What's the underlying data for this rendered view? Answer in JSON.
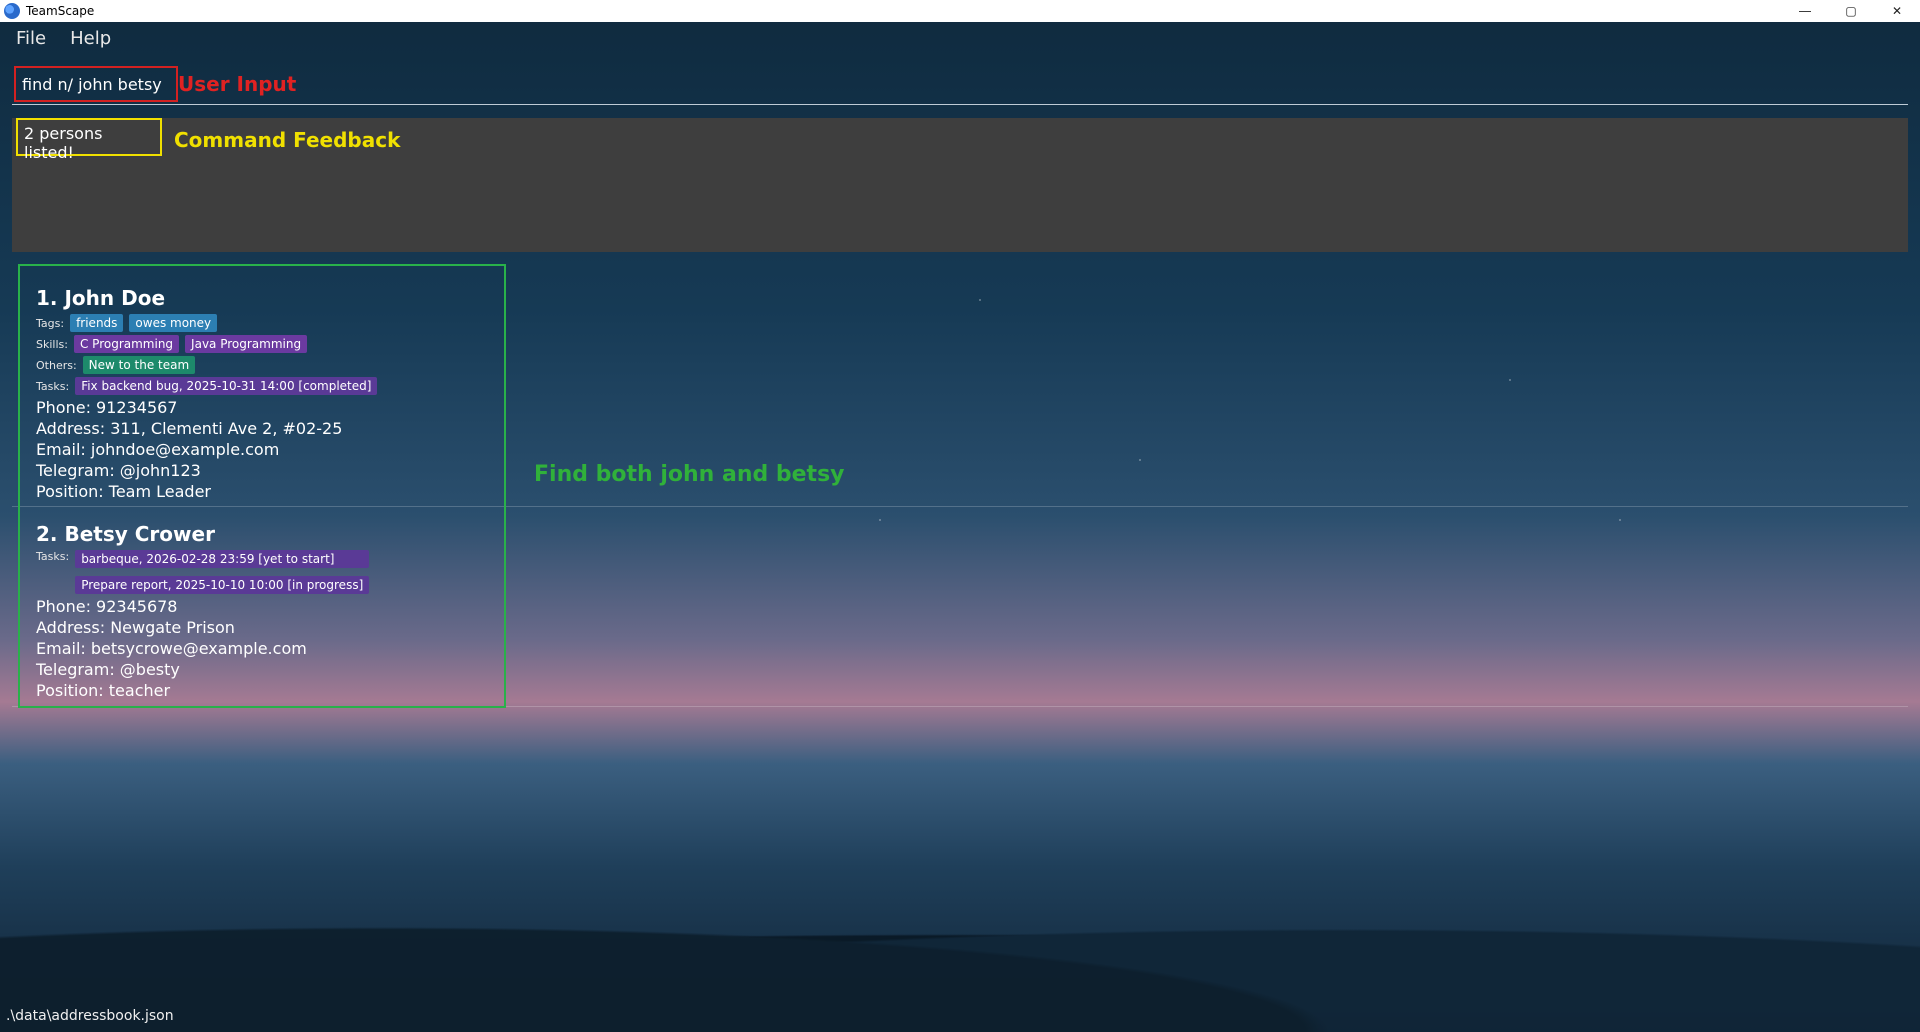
{
  "window": {
    "title": "TeamScape"
  },
  "menu": {
    "items": [
      "File",
      "Help"
    ]
  },
  "command": {
    "value": "find n/ john betsy"
  },
  "annotations": {
    "user_input": "User Input",
    "command_feedback": "Command Feedback",
    "find_note": "Find both john and betsy"
  },
  "feedback": {
    "text": "2 persons listed!"
  },
  "persons": [
    {
      "header": "1. John Doe",
      "tags_label": "Tags:",
      "tags": [
        "friends",
        "owes money"
      ],
      "skills_label": "Skills:",
      "skills": [
        "C Programming",
        "Java Programming"
      ],
      "others_label": "Others:",
      "others": [
        "New to the team"
      ],
      "tasks_label": "Tasks:",
      "tasks": [
        "Fix backend bug, 2025-10-31 14:00 [completed]"
      ],
      "phone": "Phone: 91234567",
      "address": "Address: 311, Clementi Ave 2, #02-25",
      "email": "Email: johndoe@example.com",
      "telegram": "Telegram: @john123",
      "position": "Position: Team Leader"
    },
    {
      "header": "2. Betsy Crower",
      "tasks_label": "Tasks:",
      "tasks": [
        "barbeque, 2026-02-28 23:59 [yet to start]",
        "Prepare report, 2025-10-10 10:00 [in progress]"
      ],
      "phone": "Phone: 92345678",
      "address": "Address: Newgate Prison",
      "email": "Email: betsycrowe@example.com",
      "telegram": "Telegram: @besty",
      "position": "Position: teacher"
    }
  ],
  "status": {
    "path": ".\\data\\addressbook.json"
  },
  "colors": {
    "user_input_accent": "#d32121",
    "feedback_accent": "#f0e000",
    "list_accent": "#29b14a",
    "tag_bg": "#2c7fb3",
    "skill_bg": "#6b3aa0",
    "other_bg": "#1d8a6b",
    "task_bg": "#5a3a96"
  }
}
